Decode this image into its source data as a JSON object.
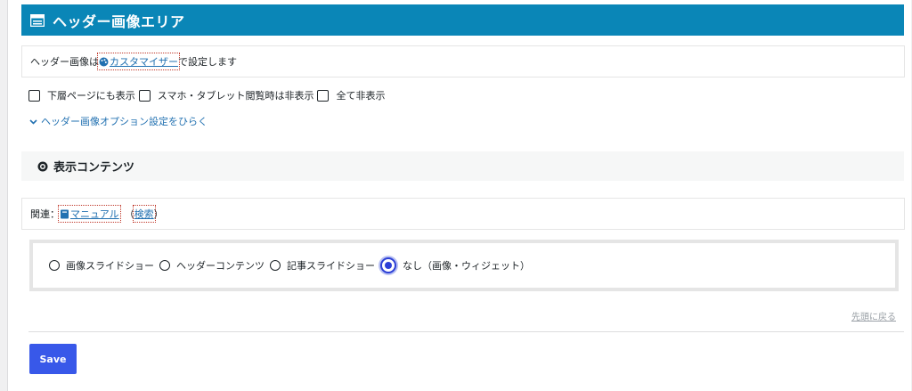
{
  "header": {
    "title": "ヘッダー画像エリア",
    "icon": "window-icon"
  },
  "info": {
    "prefix": "ヘッダー画像は",
    "link_label": "カスタマイザー",
    "suffix": "で設定します"
  },
  "checkboxes": [
    {
      "label": "下層ページにも表示",
      "checked": false
    },
    {
      "label": "スマホ・タブレット閲覧時は非表示",
      "checked": false
    },
    {
      "label": "全て非表示",
      "checked": false
    }
  ],
  "expand_link": "ヘッダー画像オプション設定をひらく",
  "content_section": {
    "title": "表示コンテンツ",
    "icon": "eye-icon"
  },
  "related": {
    "prefix": "関連：",
    "manual_label": "マニュアル",
    "search_label": "検索",
    "paren_open": "（",
    "paren_close": "）"
  },
  "radio_options": [
    {
      "label": "画像スライドショー",
      "selected": false
    },
    {
      "label": "ヘッダーコンテンツ",
      "selected": false
    },
    {
      "label": "記事スライドショー",
      "selected": false
    },
    {
      "label": "なし（画像・ウィジェット）",
      "selected": true
    }
  ],
  "back_to_top": "先頭に戻る",
  "save_label": "Save",
  "colors": {
    "header_bg": "#0a86b7",
    "link": "#2271b1",
    "primary_button": "#3858e9",
    "radio_selected": "#2c3fd6"
  }
}
